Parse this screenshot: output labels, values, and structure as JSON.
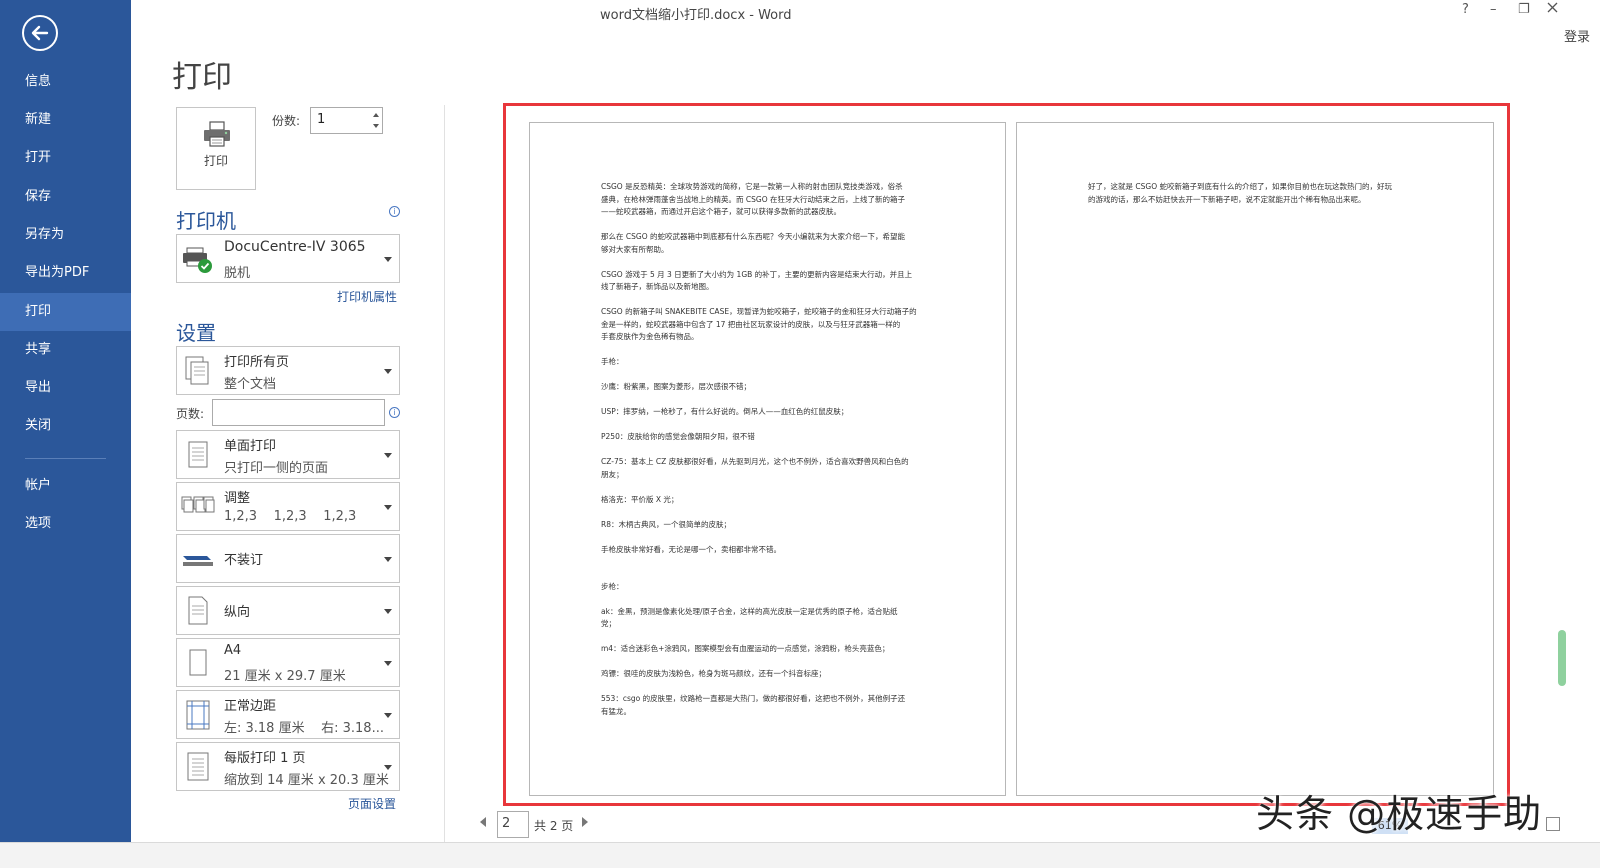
{
  "window": {
    "title": "word文档缩小打印.docx - Word",
    "help": "?",
    "minimize": "–",
    "restore": "❐",
    "login": "登录"
  },
  "sidebar": {
    "items": [
      {
        "label": "信息"
      },
      {
        "label": "新建"
      },
      {
        "label": "打开"
      },
      {
        "label": "保存"
      },
      {
        "label": "另存为"
      },
      {
        "label": "导出为PDF"
      },
      {
        "label": "打印"
      },
      {
        "label": "共享"
      },
      {
        "label": "导出"
      },
      {
        "label": "关闭"
      },
      {
        "label": "帐户"
      },
      {
        "label": "选项"
      }
    ],
    "active_index": 6
  },
  "print": {
    "title": "打印",
    "button_label": "打印",
    "copies_label": "份数:",
    "copies_value": "1"
  },
  "printer": {
    "heading": "打印机",
    "name": "DocuCentre-IV 3065",
    "status": "脱机",
    "properties_link": "打印机属性"
  },
  "settings": {
    "heading": "设置",
    "pages_label": "页数:",
    "pages_value": "",
    "page_setup_link": "页面设置",
    "print_range": {
      "main": "打印所有页",
      "sub": "整个文档"
    },
    "sides": {
      "main": "单面打印",
      "sub": "只打印一侧的页面"
    },
    "collate": {
      "main": "调整",
      "sub": "1,2,3    1,2,3    1,2,3"
    },
    "binding": {
      "main": "不装订"
    },
    "orientation": {
      "main": "纵向"
    },
    "paper": {
      "main": "A4",
      "sub": "21 厘米 x 29.7 厘米"
    },
    "margins": {
      "main": "正常边距",
      "sub": "左: 3.18 厘米    右: 3.18..."
    },
    "per_sheet": {
      "main": "每版打印 1 页",
      "sub": "缩放到 14 厘米 x 20.3 厘米"
    }
  },
  "preview": {
    "page1": [
      [
        "CSGO 是反恐精英：全球攻势游戏的简称，它是一款第一人称的射击团队竞技类游戏，俗杀",
        "盛典，在枪林弹雨蓬舍当战地上的精英。而 CSGO 在狂牙大行动结束之后，上线了新的箱子",
        "——蛇咬武器箱，而通过开启这个箱子，就可以获得多款新的武器皮肤。"
      ],
      [
        "那么在 CSGO 的蛇咬武器箱中到底都有什么东西呢？今天小编就来为大家介绍一下，希望能",
        "够对大家有所帮助。"
      ],
      [
        "CSGO 游戏于 5 月 3 日更新了大小约为 1GB 的补丁，主要的更新内容是结束大行动，并且上",
        "线了新箱子，新饰品以及新地图。"
      ],
      [
        "CSGO 的新箱子叫 SNAKEBITE CASE，现暂译为蛇咬箱子，蛇咬箱子的金和狂牙大行动箱子的",
        "金是一样的，蛇咬武器箱中包含了 17 把由社区玩家设计的皮肤，以及与狂牙武器箱一样的",
        "手套皮肤作为金色稀有物品。"
      ],
      [
        "手枪："
      ],
      [
        "沙鹰：粉紫黑，图案为菱形，层次感很不错；"
      ],
      [
        "USP：摔罗纳，一枪秒了，有什么好说的。倒吊人——血红色的红鼠皮肤；"
      ],
      [
        "P250：皮肤给你的感觉会像朝阳夕阳，很不错"
      ],
      [
        "CZ-75：基本上 CZ 皮肤都很好看，从先驱到月光，这个也不例外，适合喜欢野兽风和白色的",
        "朋友；"
      ],
      [
        "格洛克：平价版 X 光；"
      ],
      [
        "R8：木柄古典风，一个很简单的皮肤；"
      ],
      [
        "手枪皮肤非常好看，无论是哪一个，卖相都非常不错。"
      ],
      [
        "步枪："
      ],
      [
        "ak：金黑，预测是像素化处理/原子合金，这样的高光皮肤一定是优秀的原子枪，适合贴纸",
        "党；"
      ],
      [
        "m4：适合迷彩色+涂鸦风，图案模型会有血腥运动的一点感觉，涂鸦粉，枪头亮蓝色；"
      ],
      [
        "鸡镖：很哇的皮肤为浅粉色，枪身为斑马颜纹，还有一个抖音标座；"
      ],
      [
        "553：csgo 的皮肤里，纹路枪一直都是大热门，做的都很好看，这把也不例外，其他例子还",
        "有猛龙。"
      ]
    ],
    "page2": [
      [
        "好了，这就是 CSGO 蛇咬新箱子到底有什么的介绍了，如果你目前也在玩这款热门的，好玩",
        "的游戏的话，那么不妨赶快去开一下新箱子吧，说不定就能开出个稀有物品出来呢。"
      ]
    ]
  },
  "pager": {
    "current": "2",
    "total": "共 2 页"
  },
  "zoom": {
    "value": "61%"
  },
  "watermark": "头条 @极速手助",
  "colors": {
    "sidebar": "#2b579a",
    "sidebar_active": "#3e6db5",
    "accent_blue": "#2b579a",
    "preview_border": "#e8363b"
  }
}
